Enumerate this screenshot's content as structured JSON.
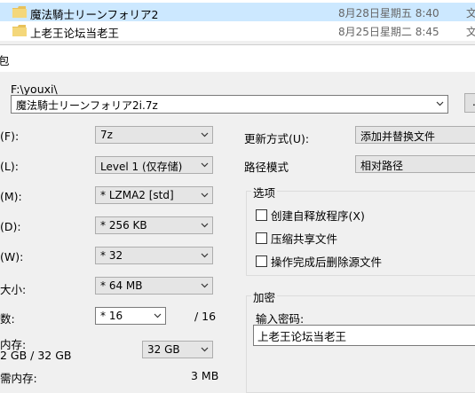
{
  "explorer": {
    "rows": [
      {
        "name": "魔法騎士リーンフォリア2",
        "date": "8月28日星期五 8:40",
        "type": "文",
        "selected": true
      },
      {
        "name": "上老王论坛当老王",
        "date": "8月25日星期二 8:45",
        "type": "文",
        "selected": false
      }
    ]
  },
  "dialog": {
    "title_fragment": "包",
    "path_label": "F:\\youxi\\",
    "archive_name": "魔法騎士リーンフォリア2i.7z",
    "browse_label": "...",
    "left": {
      "format_label": "(F):",
      "format_value": "7z",
      "level_label": "(L):",
      "level_value": "Level 1 (仅存储)",
      "method_label": "(M):",
      "method_value": "* LZMA2 [std]",
      "dict_label": "(D):",
      "dict_value": "* 256 KB",
      "word_label": "(W):",
      "word_value": "* 32",
      "solid_label": "大小:",
      "solid_value": "* 64 MB",
      "threads_label": "数:",
      "threads_value": "* 16",
      "threads_max": "/ 16",
      "memory_label": "内存:",
      "memory_info": "2 GB / 32 GB",
      "memory_value": "32 GB",
      "decomp_label": "需内存:",
      "decomp_value": "3 MB"
    },
    "right": {
      "update_label": "更新方式(U):",
      "update_value": "添加并替换文件",
      "pathmode_label": "路径模式",
      "pathmode_value": "相对路径",
      "options_title": "选项",
      "options": [
        {
          "label": "创建自释放程序(X)",
          "checked": false
        },
        {
          "label": "压缩共享文件",
          "checked": false
        },
        {
          "label": "操作完成后删除源文件",
          "checked": false
        }
      ],
      "encrypt_title": "加密",
      "password_label": "输入密码:",
      "password_value": "上老王论坛当老王"
    }
  },
  "colors": {
    "selection": "#cce8ff",
    "folder": "#e8c15a",
    "dialog_bg": "#f0f0f0"
  },
  "icons": [
    "folder-icon",
    "chevron-down-icon"
  ]
}
